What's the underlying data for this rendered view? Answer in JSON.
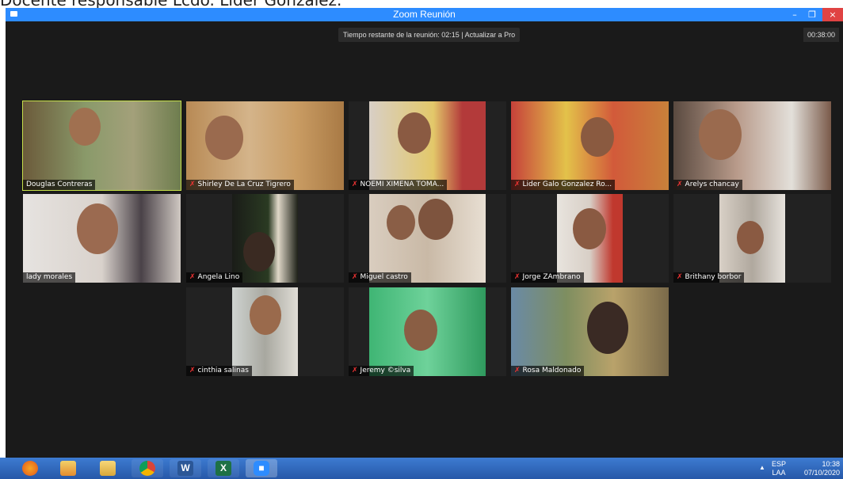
{
  "caption": "Docente responsable Lcdo. Líder Gonzalez.",
  "window": {
    "title": "Zoom Reunión",
    "minimize": "–",
    "maximize": "❐",
    "close": "×"
  },
  "banner": "Tiempo restante de la reunión: 02:15 | Actualizar a Pro",
  "timer": "00:38:00",
  "participants": [
    {
      "name": "Douglas Contreras",
      "muted": false
    },
    {
      "name": "Shirley De La Cruz Tigrero",
      "muted": true
    },
    {
      "name": "NOEMI   XIMENA TOMA...",
      "muted": true
    },
    {
      "name": "Lider Galo Gonzalez Ro...",
      "muted": true
    },
    {
      "name": "Arelys chancay",
      "muted": true
    },
    {
      "name": "lady morales",
      "muted": false
    },
    {
      "name": "Angela Lino",
      "muted": true
    },
    {
      "name": "Miguel castro",
      "muted": true
    },
    {
      "name": "Jorge ZAmbrano",
      "muted": true
    },
    {
      "name": "Brithany borbor",
      "muted": true
    },
    {
      "name": "cinthia salinas",
      "muted": true
    },
    {
      "name": "Jeremy ©silva",
      "muted": true
    },
    {
      "name": "Rosa Maldonado",
      "muted": true
    }
  ],
  "taskbar": {
    "apps": [
      "firefox-icon",
      "paint-icon",
      "file-explorer-icon",
      "chrome-icon",
      "word-icon",
      "excel-icon",
      "zoom-icon"
    ],
    "lang_top": "ESP",
    "lang_bottom": "LAA",
    "time": "10:38",
    "date": "07/10/2020"
  },
  "colors": {
    "accent": "#2d8cff",
    "active_speaker": "#c6e04a",
    "muted": "#e33333"
  }
}
